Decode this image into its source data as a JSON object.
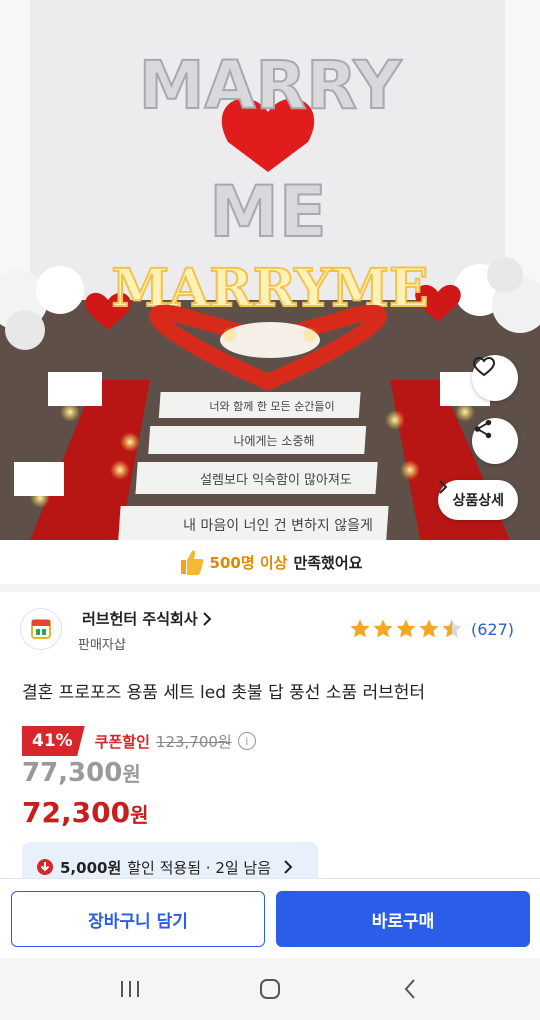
{
  "hero": {
    "balloon_top": "MARRY",
    "balloon_bottom": "ME",
    "marquee": "MARRYME",
    "cards": [
      "너와 함께 한 모든 순간들이",
      "나에게는 소중해",
      "설렘보다 익숙함이 많아져도",
      "내 마음이 너인 건 변하지 않을게"
    ],
    "detail_label": "상품상세"
  },
  "satisfy": {
    "highlight": "500명 이상",
    "rest": "만족했어요"
  },
  "seller": {
    "name": "러브헌터 주식회사",
    "sub": "판매자샵",
    "rating": 4.5,
    "review_count": "(627)"
  },
  "product": {
    "title": "결혼 프로포즈 용품 세트 led 촛불 답 풍선 소품 러브헌터"
  },
  "price": {
    "discount_pct": "41%",
    "coupon_label": "쿠폰할인",
    "original": "123,700원",
    "sale_value": "77,300",
    "final_value": "72,300",
    "won": "원"
  },
  "coupon_box": {
    "amount": "5,000원",
    "text": "할인 적용됨 · 2일 남음"
  },
  "actions": {
    "cart": "장바구니 담기",
    "buy": "바로구매"
  },
  "colors": {
    "brand_blue": "#2a5de8",
    "sale_red": "#d6272d",
    "star": "#f5a623"
  }
}
